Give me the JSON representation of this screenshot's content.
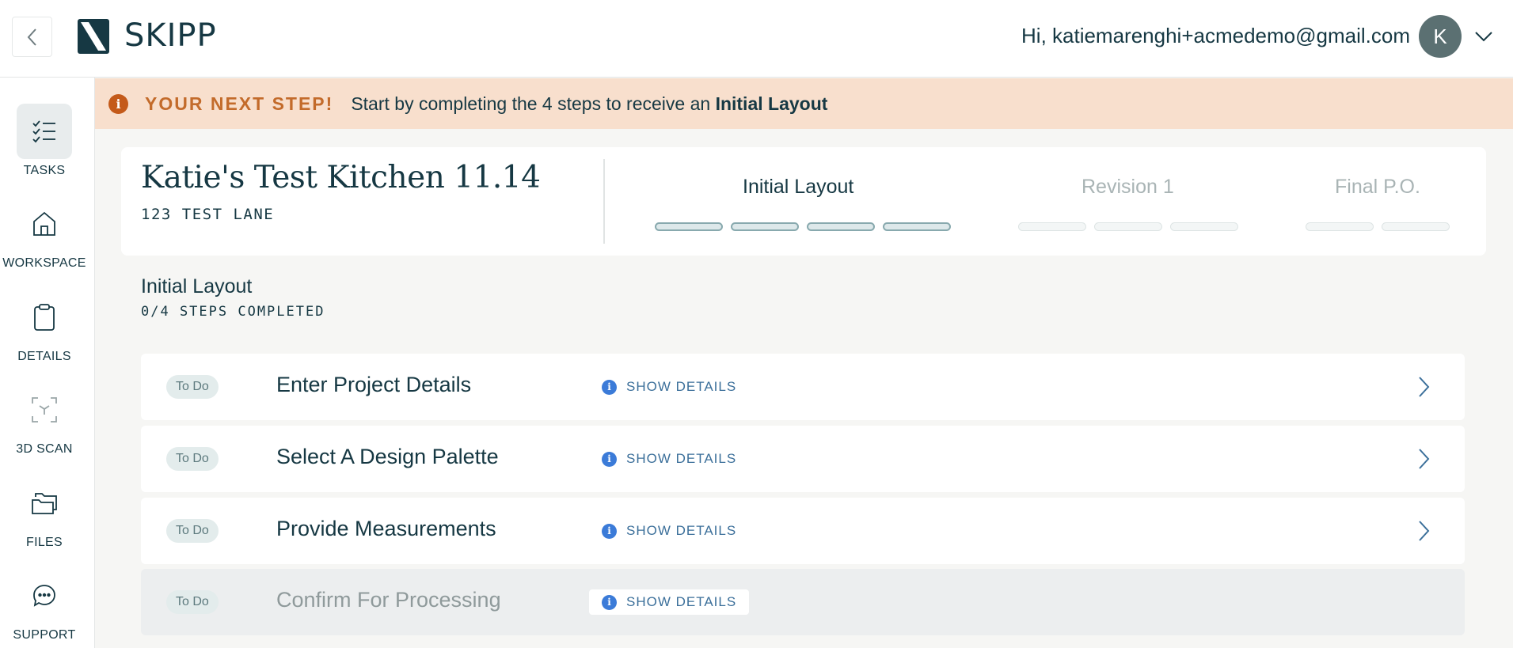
{
  "header": {
    "brand": "SKIPP",
    "greeting": "Hi, katiemarenghi+acmedemo@gmail.com",
    "avatar_initial": "K",
    "icons": {
      "back": "chevron-left-icon",
      "menu": "chevron-down-icon",
      "logo": "skipp-logo-icon"
    }
  },
  "sidebar": {
    "items": [
      {
        "label": "TASKS",
        "icon": "checklist-icon",
        "active": true
      },
      {
        "label": "WORKSPACE",
        "icon": "home-icon",
        "active": false
      },
      {
        "label": "DETAILS",
        "icon": "clipboard-icon",
        "active": false
      },
      {
        "label": "3D SCAN",
        "icon": "scan-icon",
        "active": false
      },
      {
        "label": "FILES",
        "icon": "folders-icon",
        "active": false
      },
      {
        "label": "SUPPORT",
        "icon": "chat-icon",
        "active": false
      }
    ]
  },
  "banner": {
    "title": "YOUR NEXT STEP!",
    "message_prefix": "Start by completing the 4 steps to receive an ",
    "message_bold": "Initial Layout",
    "accent": "#c45a1a",
    "background": "#f8dfcd"
  },
  "project": {
    "name": "Katie's Test Kitchen 11.14",
    "address": "123 TEST LANE",
    "phases": [
      {
        "label": "Initial Layout",
        "segments": 4,
        "state": "current"
      },
      {
        "label": "Revision 1",
        "segments": 3,
        "state": "future"
      },
      {
        "label": "Final P.O.",
        "segments": 2,
        "state": "future"
      }
    ]
  },
  "section": {
    "title": "Initial Layout",
    "subtitle": "0/4 STEPS COMPLETED"
  },
  "tasks": [
    {
      "status": "To Do",
      "name": "Enter Project Details",
      "details_label": "SHOW DETAILS",
      "enabled": true
    },
    {
      "status": "To Do",
      "name": "Select A Design Palette",
      "details_label": "SHOW DETAILS",
      "enabled": true
    },
    {
      "status": "To Do",
      "name": "Provide Measurements",
      "details_label": "SHOW DETAILS",
      "enabled": true
    },
    {
      "status": "To Do",
      "name": "Confirm For Processing",
      "details_label": "SHOW DETAILS",
      "enabled": false
    }
  ],
  "colors": {
    "primary_text": "#163843",
    "link": "#3b6f9a",
    "info": "#3b7bd8"
  }
}
